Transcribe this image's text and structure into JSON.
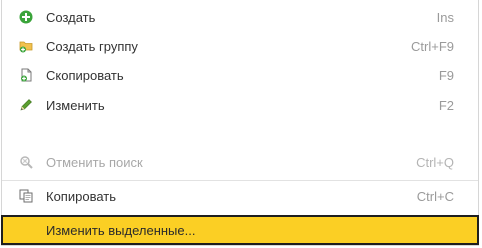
{
  "menu": {
    "items": [
      {
        "label": "Создать",
        "shortcut": "Ins",
        "icon": "add-circle-icon"
      },
      {
        "label": "Создать группу",
        "shortcut": "Ctrl+F9",
        "icon": "folder-add-icon"
      },
      {
        "label": "Скопировать",
        "shortcut": "F9",
        "icon": "copy-document-icon"
      },
      {
        "label": "Изменить",
        "shortcut": "F2",
        "icon": "pencil-icon"
      },
      {
        "label": "Отменить поиск",
        "shortcut": "Ctrl+Q",
        "icon": "cancel-search-icon",
        "disabled": true
      },
      {
        "label": "Копировать",
        "shortcut": "Ctrl+C",
        "icon": "copy-icon"
      },
      {
        "label": "Изменить выделенные...",
        "shortcut": "",
        "icon": "",
        "highlighted": true
      }
    ]
  },
  "colors": {
    "highlight": "#fbcf24",
    "highlight_border": "#1e1e1e",
    "add_green": "#3aa43a",
    "folder_yellow": "#f2c14e",
    "pencil_green": "#5a9e2f"
  }
}
